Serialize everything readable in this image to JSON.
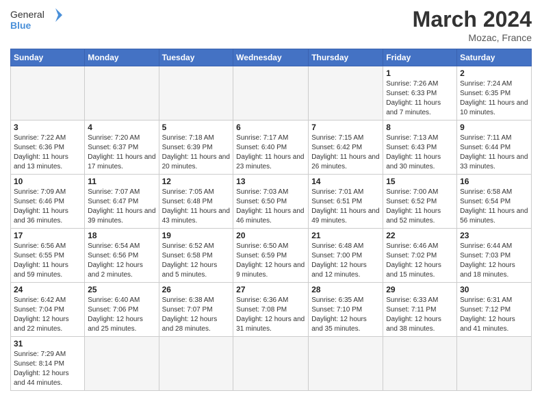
{
  "header": {
    "logo_general": "General",
    "logo_blue": "Blue",
    "month_title": "March 2024",
    "location": "Mozac, France"
  },
  "days_of_week": [
    "Sunday",
    "Monday",
    "Tuesday",
    "Wednesday",
    "Thursday",
    "Friday",
    "Saturday"
  ],
  "weeks": [
    [
      {
        "day": "",
        "info": "",
        "empty": true
      },
      {
        "day": "",
        "info": "",
        "empty": true
      },
      {
        "day": "",
        "info": "",
        "empty": true
      },
      {
        "day": "",
        "info": "",
        "empty": true
      },
      {
        "day": "",
        "info": "",
        "empty": true
      },
      {
        "day": "1",
        "info": "Sunrise: 7:26 AM\nSunset: 6:33 PM\nDaylight: 11 hours and 7 minutes."
      },
      {
        "day": "2",
        "info": "Sunrise: 7:24 AM\nSunset: 6:35 PM\nDaylight: 11 hours and 10 minutes."
      }
    ],
    [
      {
        "day": "3",
        "info": "Sunrise: 7:22 AM\nSunset: 6:36 PM\nDaylight: 11 hours and 13 minutes."
      },
      {
        "day": "4",
        "info": "Sunrise: 7:20 AM\nSunset: 6:37 PM\nDaylight: 11 hours and 17 minutes."
      },
      {
        "day": "5",
        "info": "Sunrise: 7:18 AM\nSunset: 6:39 PM\nDaylight: 11 hours and 20 minutes."
      },
      {
        "day": "6",
        "info": "Sunrise: 7:17 AM\nSunset: 6:40 PM\nDaylight: 11 hours and 23 minutes."
      },
      {
        "day": "7",
        "info": "Sunrise: 7:15 AM\nSunset: 6:42 PM\nDaylight: 11 hours and 26 minutes."
      },
      {
        "day": "8",
        "info": "Sunrise: 7:13 AM\nSunset: 6:43 PM\nDaylight: 11 hours and 30 minutes."
      },
      {
        "day": "9",
        "info": "Sunrise: 7:11 AM\nSunset: 6:44 PM\nDaylight: 11 hours and 33 minutes."
      }
    ],
    [
      {
        "day": "10",
        "info": "Sunrise: 7:09 AM\nSunset: 6:46 PM\nDaylight: 11 hours and 36 minutes."
      },
      {
        "day": "11",
        "info": "Sunrise: 7:07 AM\nSunset: 6:47 PM\nDaylight: 11 hours and 39 minutes."
      },
      {
        "day": "12",
        "info": "Sunrise: 7:05 AM\nSunset: 6:48 PM\nDaylight: 11 hours and 43 minutes."
      },
      {
        "day": "13",
        "info": "Sunrise: 7:03 AM\nSunset: 6:50 PM\nDaylight: 11 hours and 46 minutes."
      },
      {
        "day": "14",
        "info": "Sunrise: 7:01 AM\nSunset: 6:51 PM\nDaylight: 11 hours and 49 minutes."
      },
      {
        "day": "15",
        "info": "Sunrise: 7:00 AM\nSunset: 6:52 PM\nDaylight: 11 hours and 52 minutes."
      },
      {
        "day": "16",
        "info": "Sunrise: 6:58 AM\nSunset: 6:54 PM\nDaylight: 11 hours and 56 minutes."
      }
    ],
    [
      {
        "day": "17",
        "info": "Sunrise: 6:56 AM\nSunset: 6:55 PM\nDaylight: 11 hours and 59 minutes."
      },
      {
        "day": "18",
        "info": "Sunrise: 6:54 AM\nSunset: 6:56 PM\nDaylight: 12 hours and 2 minutes."
      },
      {
        "day": "19",
        "info": "Sunrise: 6:52 AM\nSunset: 6:58 PM\nDaylight: 12 hours and 5 minutes."
      },
      {
        "day": "20",
        "info": "Sunrise: 6:50 AM\nSunset: 6:59 PM\nDaylight: 12 hours and 9 minutes."
      },
      {
        "day": "21",
        "info": "Sunrise: 6:48 AM\nSunset: 7:00 PM\nDaylight: 12 hours and 12 minutes."
      },
      {
        "day": "22",
        "info": "Sunrise: 6:46 AM\nSunset: 7:02 PM\nDaylight: 12 hours and 15 minutes."
      },
      {
        "day": "23",
        "info": "Sunrise: 6:44 AM\nSunset: 7:03 PM\nDaylight: 12 hours and 18 minutes."
      }
    ],
    [
      {
        "day": "24",
        "info": "Sunrise: 6:42 AM\nSunset: 7:04 PM\nDaylight: 12 hours and 22 minutes."
      },
      {
        "day": "25",
        "info": "Sunrise: 6:40 AM\nSunset: 7:06 PM\nDaylight: 12 hours and 25 minutes."
      },
      {
        "day": "26",
        "info": "Sunrise: 6:38 AM\nSunset: 7:07 PM\nDaylight: 12 hours and 28 minutes."
      },
      {
        "day": "27",
        "info": "Sunrise: 6:36 AM\nSunset: 7:08 PM\nDaylight: 12 hours and 31 minutes."
      },
      {
        "day": "28",
        "info": "Sunrise: 6:35 AM\nSunset: 7:10 PM\nDaylight: 12 hours and 35 minutes."
      },
      {
        "day": "29",
        "info": "Sunrise: 6:33 AM\nSunset: 7:11 PM\nDaylight: 12 hours and 38 minutes."
      },
      {
        "day": "30",
        "info": "Sunrise: 6:31 AM\nSunset: 7:12 PM\nDaylight: 12 hours and 41 minutes."
      }
    ],
    [
      {
        "day": "31",
        "info": "Sunrise: 7:29 AM\nSunset: 8:14 PM\nDaylight: 12 hours and 44 minutes."
      },
      {
        "day": "",
        "info": "",
        "empty": true
      },
      {
        "day": "",
        "info": "",
        "empty": true
      },
      {
        "day": "",
        "info": "",
        "empty": true
      },
      {
        "day": "",
        "info": "",
        "empty": true
      },
      {
        "day": "",
        "info": "",
        "empty": true
      },
      {
        "day": "",
        "info": "",
        "empty": true
      }
    ]
  ]
}
